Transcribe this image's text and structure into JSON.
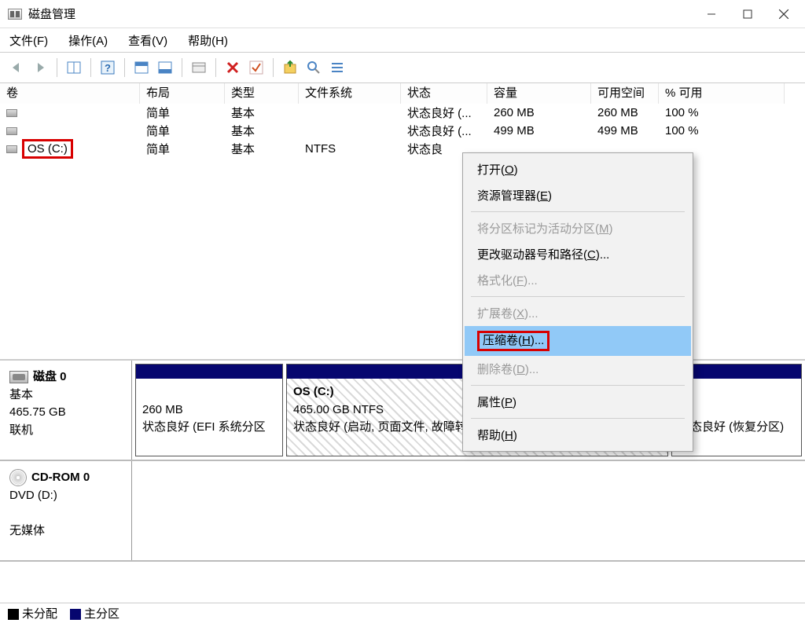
{
  "window": {
    "title": "磁盘管理"
  },
  "menu": {
    "file": "文件(F)",
    "operate": "操作(A)",
    "view": "查看(V)",
    "help": "帮助(H)"
  },
  "columns": {
    "volume": "卷",
    "layout": "布局",
    "type": "类型",
    "fs": "文件系统",
    "status": "状态",
    "size": "容量",
    "free": "可用空间",
    "pct": "% 可用"
  },
  "volumes": [
    {
      "name": "",
      "layout": "简单",
      "type": "基本",
      "fs": "",
      "status": "状态良好 (...",
      "size": "260 MB",
      "free": "260 MB",
      "pct": "100 %"
    },
    {
      "name": "",
      "layout": "简单",
      "type": "基本",
      "fs": "",
      "status": "状态良好 (...",
      "size": "499 MB",
      "free": "499 MB",
      "pct": "100 %"
    },
    {
      "name": "OS (C:)",
      "layout": "简单",
      "type": "基本",
      "fs": "NTFS",
      "status": "状态良",
      "size": "",
      "free": "",
      "pct": ""
    }
  ],
  "contextMenu": {
    "open": "打开(O)",
    "explorer": "资源管理器(E)",
    "markActive": "将分区标记为活动分区(M)",
    "changeDrive": "更改驱动器号和路径(C)...",
    "format": "格式化(F)...",
    "extend": "扩展卷(X)...",
    "shrink": "压缩卷(H)...",
    "delete": "删除卷(D)...",
    "properties": "属性(P)",
    "help": "帮助(H)"
  },
  "disks": {
    "disk0": {
      "title": "磁盘 0",
      "type": "基本",
      "size": "465.75 GB",
      "state": "联机"
    },
    "part0": {
      "size": "260 MB",
      "status": "状态良好 (EFI 系统分区"
    },
    "part1": {
      "title": "OS  (C:)",
      "size": "465.00 GB NTFS",
      "status": "状态良好 (启动, 页面文件, 故障转储, 主分区)"
    },
    "part2": {
      "status": "状态良好 (恢复分区)"
    },
    "cd": {
      "title": "CD-ROM 0",
      "sub": "DVD (D:)",
      "state": "无媒体"
    }
  },
  "legend": {
    "unallocated": "未分配",
    "primary": "主分区"
  }
}
